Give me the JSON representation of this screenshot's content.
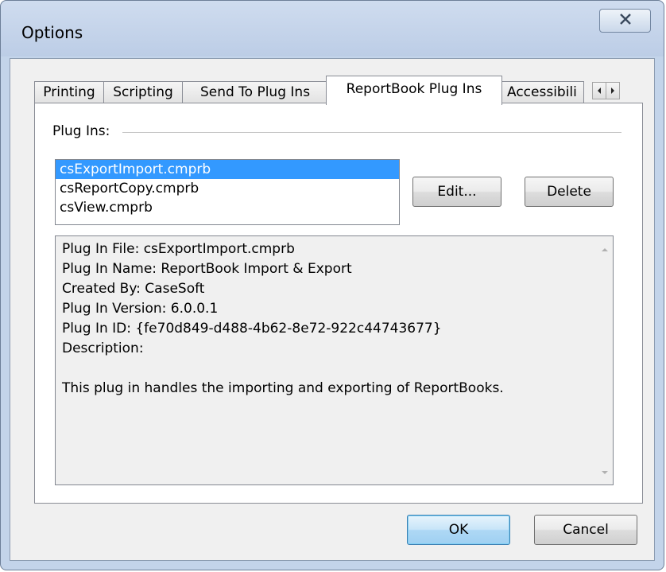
{
  "window": {
    "title": "Options",
    "close_label": "X"
  },
  "tabs": [
    {
      "label": "Printing",
      "active": false
    },
    {
      "label": "Scripting",
      "active": false
    },
    {
      "label": "Send To Plug Ins",
      "active": false
    },
    {
      "label": "ReportBook Plug Ins",
      "active": true
    },
    {
      "label": "Accessibili",
      "active": false
    }
  ],
  "panel": {
    "group_label": "Plug Ins:",
    "plugins": [
      {
        "name": "csExportImport.cmprb",
        "selected": true
      },
      {
        "name": "csReportCopy.cmprb",
        "selected": false
      },
      {
        "name": "csView.cmprb",
        "selected": false
      }
    ],
    "edit_label": "Edit...",
    "delete_label": "Delete",
    "details": [
      "Plug In File: csExportImport.cmprb",
      "Plug In Name: ReportBook Import & Export",
      "Created By: CaseSoft",
      "Plug In Version: 6.0.0.1",
      "Plug In ID: {fe70d849-d488-4b62-8e72-922c44743677}",
      "Description:",
      "",
      "This plug in handles the importing and exporting of ReportBooks."
    ]
  },
  "footer": {
    "ok_label": "OK",
    "cancel_label": "Cancel"
  },
  "icons": {
    "close": "close-icon",
    "tab_scroll_left": "arrow-left-icon",
    "tab_scroll_right": "arrow-right-icon",
    "scroll_up": "arrow-up-icon",
    "scroll_down": "arrow-down-icon"
  },
  "colors": {
    "frame": "#c3d4ea",
    "selection": "#3399ff",
    "client": "#f0f0f0"
  }
}
